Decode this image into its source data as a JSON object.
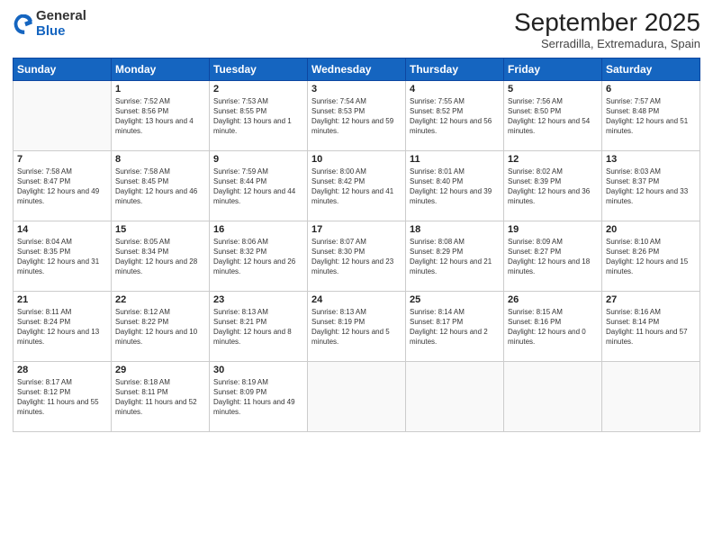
{
  "logo": {
    "general": "General",
    "blue": "Blue"
  },
  "header": {
    "title": "September 2025",
    "subtitle": "Serradilla, Extremadura, Spain"
  },
  "weekdays": [
    "Sunday",
    "Monday",
    "Tuesday",
    "Wednesday",
    "Thursday",
    "Friday",
    "Saturday"
  ],
  "weeks": [
    [
      {
        "day": "",
        "sunrise": "",
        "sunset": "",
        "daylight": ""
      },
      {
        "day": "1",
        "sunrise": "Sunrise: 7:52 AM",
        "sunset": "Sunset: 8:56 PM",
        "daylight": "Daylight: 13 hours and 4 minutes."
      },
      {
        "day": "2",
        "sunrise": "Sunrise: 7:53 AM",
        "sunset": "Sunset: 8:55 PM",
        "daylight": "Daylight: 13 hours and 1 minute."
      },
      {
        "day": "3",
        "sunrise": "Sunrise: 7:54 AM",
        "sunset": "Sunset: 8:53 PM",
        "daylight": "Daylight: 12 hours and 59 minutes."
      },
      {
        "day": "4",
        "sunrise": "Sunrise: 7:55 AM",
        "sunset": "Sunset: 8:52 PM",
        "daylight": "Daylight: 12 hours and 56 minutes."
      },
      {
        "day": "5",
        "sunrise": "Sunrise: 7:56 AM",
        "sunset": "Sunset: 8:50 PM",
        "daylight": "Daylight: 12 hours and 54 minutes."
      },
      {
        "day": "6",
        "sunrise": "Sunrise: 7:57 AM",
        "sunset": "Sunset: 8:48 PM",
        "daylight": "Daylight: 12 hours and 51 minutes."
      }
    ],
    [
      {
        "day": "7",
        "sunrise": "Sunrise: 7:58 AM",
        "sunset": "Sunset: 8:47 PM",
        "daylight": "Daylight: 12 hours and 49 minutes."
      },
      {
        "day": "8",
        "sunrise": "Sunrise: 7:58 AM",
        "sunset": "Sunset: 8:45 PM",
        "daylight": "Daylight: 12 hours and 46 minutes."
      },
      {
        "day": "9",
        "sunrise": "Sunrise: 7:59 AM",
        "sunset": "Sunset: 8:44 PM",
        "daylight": "Daylight: 12 hours and 44 minutes."
      },
      {
        "day": "10",
        "sunrise": "Sunrise: 8:00 AM",
        "sunset": "Sunset: 8:42 PM",
        "daylight": "Daylight: 12 hours and 41 minutes."
      },
      {
        "day": "11",
        "sunrise": "Sunrise: 8:01 AM",
        "sunset": "Sunset: 8:40 PM",
        "daylight": "Daylight: 12 hours and 39 minutes."
      },
      {
        "day": "12",
        "sunrise": "Sunrise: 8:02 AM",
        "sunset": "Sunset: 8:39 PM",
        "daylight": "Daylight: 12 hours and 36 minutes."
      },
      {
        "day": "13",
        "sunrise": "Sunrise: 8:03 AM",
        "sunset": "Sunset: 8:37 PM",
        "daylight": "Daylight: 12 hours and 33 minutes."
      }
    ],
    [
      {
        "day": "14",
        "sunrise": "Sunrise: 8:04 AM",
        "sunset": "Sunset: 8:35 PM",
        "daylight": "Daylight: 12 hours and 31 minutes."
      },
      {
        "day": "15",
        "sunrise": "Sunrise: 8:05 AM",
        "sunset": "Sunset: 8:34 PM",
        "daylight": "Daylight: 12 hours and 28 minutes."
      },
      {
        "day": "16",
        "sunrise": "Sunrise: 8:06 AM",
        "sunset": "Sunset: 8:32 PM",
        "daylight": "Daylight: 12 hours and 26 minutes."
      },
      {
        "day": "17",
        "sunrise": "Sunrise: 8:07 AM",
        "sunset": "Sunset: 8:30 PM",
        "daylight": "Daylight: 12 hours and 23 minutes."
      },
      {
        "day": "18",
        "sunrise": "Sunrise: 8:08 AM",
        "sunset": "Sunset: 8:29 PM",
        "daylight": "Daylight: 12 hours and 21 minutes."
      },
      {
        "day": "19",
        "sunrise": "Sunrise: 8:09 AM",
        "sunset": "Sunset: 8:27 PM",
        "daylight": "Daylight: 12 hours and 18 minutes."
      },
      {
        "day": "20",
        "sunrise": "Sunrise: 8:10 AM",
        "sunset": "Sunset: 8:26 PM",
        "daylight": "Daylight: 12 hours and 15 minutes."
      }
    ],
    [
      {
        "day": "21",
        "sunrise": "Sunrise: 8:11 AM",
        "sunset": "Sunset: 8:24 PM",
        "daylight": "Daylight: 12 hours and 13 minutes."
      },
      {
        "day": "22",
        "sunrise": "Sunrise: 8:12 AM",
        "sunset": "Sunset: 8:22 PM",
        "daylight": "Daylight: 12 hours and 10 minutes."
      },
      {
        "day": "23",
        "sunrise": "Sunrise: 8:13 AM",
        "sunset": "Sunset: 8:21 PM",
        "daylight": "Daylight: 12 hours and 8 minutes."
      },
      {
        "day": "24",
        "sunrise": "Sunrise: 8:13 AM",
        "sunset": "Sunset: 8:19 PM",
        "daylight": "Daylight: 12 hours and 5 minutes."
      },
      {
        "day": "25",
        "sunrise": "Sunrise: 8:14 AM",
        "sunset": "Sunset: 8:17 PM",
        "daylight": "Daylight: 12 hours and 2 minutes."
      },
      {
        "day": "26",
        "sunrise": "Sunrise: 8:15 AM",
        "sunset": "Sunset: 8:16 PM",
        "daylight": "Daylight: 12 hours and 0 minutes."
      },
      {
        "day": "27",
        "sunrise": "Sunrise: 8:16 AM",
        "sunset": "Sunset: 8:14 PM",
        "daylight": "Daylight: 11 hours and 57 minutes."
      }
    ],
    [
      {
        "day": "28",
        "sunrise": "Sunrise: 8:17 AM",
        "sunset": "Sunset: 8:12 PM",
        "daylight": "Daylight: 11 hours and 55 minutes."
      },
      {
        "day": "29",
        "sunrise": "Sunrise: 8:18 AM",
        "sunset": "Sunset: 8:11 PM",
        "daylight": "Daylight: 11 hours and 52 minutes."
      },
      {
        "day": "30",
        "sunrise": "Sunrise: 8:19 AM",
        "sunset": "Sunset: 8:09 PM",
        "daylight": "Daylight: 11 hours and 49 minutes."
      },
      {
        "day": "",
        "sunrise": "",
        "sunset": "",
        "daylight": ""
      },
      {
        "day": "",
        "sunrise": "",
        "sunset": "",
        "daylight": ""
      },
      {
        "day": "",
        "sunrise": "",
        "sunset": "",
        "daylight": ""
      },
      {
        "day": "",
        "sunrise": "",
        "sunset": "",
        "daylight": ""
      }
    ]
  ]
}
